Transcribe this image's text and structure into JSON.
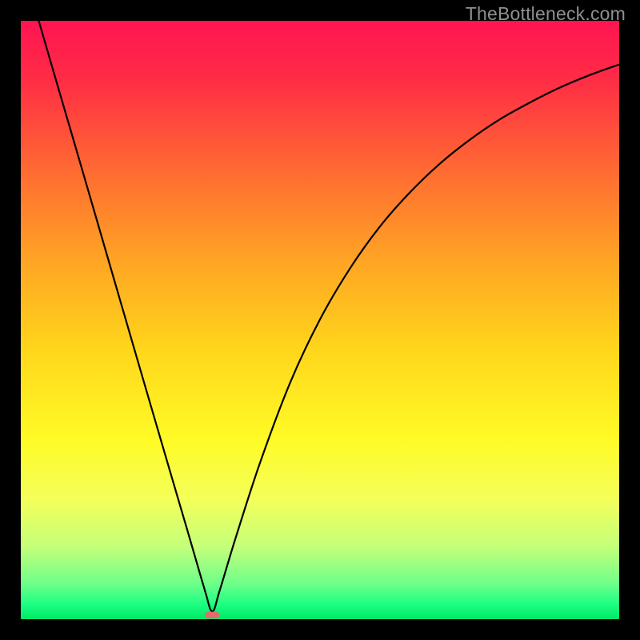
{
  "watermark": "TheBottleneck.com",
  "chart_data": {
    "type": "line",
    "title": "",
    "xlabel": "",
    "ylabel": "",
    "xlim": [
      0,
      100
    ],
    "ylim": [
      0,
      100
    ],
    "x": [
      3.0,
      5,
      10,
      15,
      20,
      25,
      28,
      30,
      31,
      31.7,
      32.3,
      33,
      34,
      36,
      40,
      45,
      50,
      55,
      60,
      65,
      70,
      75,
      80,
      85,
      90,
      95,
      100
    ],
    "y": [
      100,
      93.1,
      76.0,
      58.8,
      41.6,
      24.5,
      14.3,
      7.4,
      4.0,
      1.6,
      1.6,
      4.0,
      7.3,
      13.9,
      26.2,
      39.5,
      50.1,
      58.6,
      65.6,
      71.3,
      76.1,
      80.1,
      83.5,
      86.3,
      88.8,
      90.9,
      92.7
    ],
    "series_name": "bottleneck-curve",
    "min_marker": {
      "x": 32.0,
      "y": 0.7,
      "width": 2.4,
      "height": 1.1,
      "color": "#e46a6f"
    },
    "background_gradient": {
      "stops": [
        {
          "offset": 0.0,
          "color": "#ff1452"
        },
        {
          "offset": 0.1,
          "color": "#ff2d45"
        },
        {
          "offset": 0.25,
          "color": "#ff6a32"
        },
        {
          "offset": 0.4,
          "color": "#ffa424"
        },
        {
          "offset": 0.55,
          "color": "#ffd61b"
        },
        {
          "offset": 0.7,
          "color": "#fffb26"
        },
        {
          "offset": 0.8,
          "color": "#f4ff5a"
        },
        {
          "offset": 0.88,
          "color": "#c3ff7a"
        },
        {
          "offset": 0.94,
          "color": "#6fff8a"
        },
        {
          "offset": 0.975,
          "color": "#1dff82"
        },
        {
          "offset": 1.0,
          "color": "#00e765"
        }
      ]
    }
  }
}
